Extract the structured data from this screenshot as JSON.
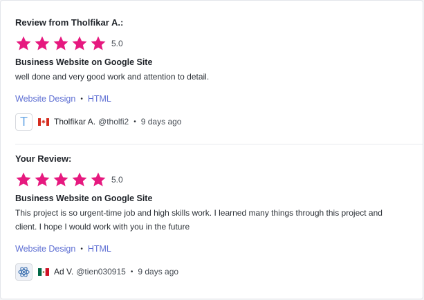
{
  "reviews": [
    {
      "heading": "Review from Tholfikar A.:",
      "stars": 5,
      "rating": "5.0",
      "project_title": "Business Website on Google Site",
      "comment": "well done and very good work and attention to detail.",
      "skills": [
        "Website Design",
        "HTML"
      ],
      "author": {
        "avatar_letter": "T",
        "flag": "canada-flag-icon",
        "name": "Tholfikar A.",
        "handle": "@tholfi2",
        "posted": "9 days ago"
      }
    },
    {
      "heading": "Your Review:",
      "stars": 5,
      "rating": "5.0",
      "project_title": "Business Website on Google Site",
      "comment": "This project is so urgent-time job and high skills work. I learned many things through this project and client. I hope I would work with you in the future",
      "skills": [
        "Website Design",
        "HTML"
      ],
      "author": {
        "avatar_icon": "atom-icon",
        "flag": "mexico-flag-icon",
        "name": "Ad V.",
        "handle": "@tien030915",
        "posted": "9 days ago"
      }
    }
  ],
  "colors": {
    "star": "#e6197f",
    "link": "#5e6fd3",
    "text": "#1f2329"
  }
}
